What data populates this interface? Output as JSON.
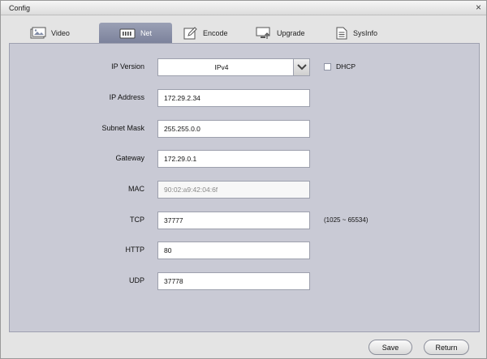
{
  "window": {
    "title": "Config",
    "close_glyph": "×"
  },
  "tabs": [
    {
      "label": "Video",
      "icon": "video-icon"
    },
    {
      "label": "Net",
      "icon": "net-icon"
    },
    {
      "label": "Encode",
      "icon": "encode-icon"
    },
    {
      "label": "Upgrade",
      "icon": "upgrade-icon"
    },
    {
      "label": "SysInfo",
      "icon": "sysinfo-icon"
    }
  ],
  "active_tab": "Net",
  "form": {
    "ip_version": {
      "label": "IP Version",
      "value": "IPv4"
    },
    "dhcp": {
      "label": "DHCP",
      "checked": false
    },
    "ip_address": {
      "label": "IP Address",
      "value": "172.29.2.34"
    },
    "subnet_mask": {
      "label": "Subnet Mask",
      "value": "255.255.0.0"
    },
    "gateway": {
      "label": "Gateway",
      "value": "172.29.0.1"
    },
    "mac": {
      "label": "MAC",
      "value": "90:02:a9:42:04:6f"
    },
    "tcp": {
      "label": "TCP",
      "value": "37777",
      "range": "(1025 ~ 65534)"
    },
    "http": {
      "label": "HTTP",
      "value": "80"
    },
    "udp": {
      "label": "UDP",
      "value": "37778"
    }
  },
  "buttons": {
    "save": "Save",
    "return": "Return"
  },
  "colors": {
    "active_tab": "#8a8fa7",
    "panel": "#c9cad5",
    "window": "#e4e4e4"
  }
}
